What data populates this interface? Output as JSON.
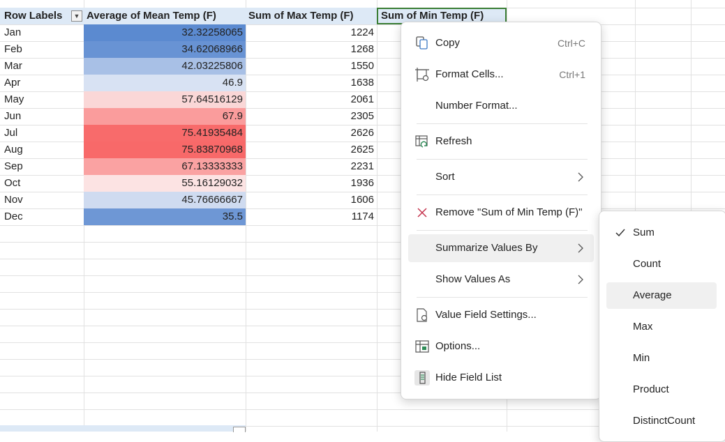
{
  "pivot": {
    "headers": {
      "row_labels": "Row Labels",
      "mean": "Average of Mean Temp (F)",
      "max": "Sum of Max Temp (F)",
      "min": "Sum of Min Temp (F)"
    },
    "rows": [
      {
        "label": "Jan",
        "mean": "32.32258065",
        "max": "1224",
        "color": "#5b8ad0"
      },
      {
        "label": "Feb",
        "mean": "34.62068966",
        "max": "1268",
        "color": "#6893d4"
      },
      {
        "label": "Mar",
        "mean": "42.03225806",
        "max": "1550",
        "color": "#a8c0e6"
      },
      {
        "label": "Apr",
        "mean": "46.9",
        "max": "1638",
        "color": "#d8e2f3"
      },
      {
        "label": "May",
        "mean": "57.64516129",
        "max": "2061",
        "color": "#fad7d7"
      },
      {
        "label": "Jun",
        "mean": "67.9",
        "max": "2305",
        "color": "#fa9c9c"
      },
      {
        "label": "Jul",
        "mean": "75.41935484",
        "max": "2626",
        "color": "#f86b6b"
      },
      {
        "label": "Aug",
        "mean": "75.83870968",
        "max": "2625",
        "color": "#f86969"
      },
      {
        "label": "Sep",
        "mean": "67.13333333",
        "max": "2231",
        "color": "#faa2a2"
      },
      {
        "label": "Oct",
        "mean": "55.16129032",
        "max": "1936",
        "color": "#fce3e3"
      },
      {
        "label": "Nov",
        "mean": "45.76666667",
        "max": "1606",
        "color": "#cfdbf0"
      },
      {
        "label": "Dec",
        "mean": "35.5",
        "max": "1174",
        "color": "#6e97d5"
      }
    ]
  },
  "context_menu": {
    "copy": {
      "label": "Copy",
      "shortcut": "Ctrl+C"
    },
    "format_cells": {
      "label": "Format Cells...",
      "shortcut": "Ctrl+1"
    },
    "number_format": {
      "label": "Number Format..."
    },
    "refresh": {
      "label": "Refresh"
    },
    "sort": {
      "label": "Sort"
    },
    "remove": {
      "label": "Remove \"Sum of Min Temp (F)\""
    },
    "summarize": {
      "label": "Summarize Values By"
    },
    "show_values": {
      "label": "Show Values As"
    },
    "value_field_settings": {
      "label": "Value Field Settings..."
    },
    "options": {
      "label": "Options..."
    },
    "hide_field_list": {
      "label": "Hide Field List"
    }
  },
  "summarize_submenu": {
    "items": [
      "Sum",
      "Count",
      "Average",
      "Max",
      "Min",
      "Product",
      "DistinctCount"
    ],
    "checked": "Sum",
    "hovered": "Average"
  },
  "colors": {
    "header_bg": "#dde9f6",
    "selected_border": "#3a7d34",
    "remove_icon": "#c4314b",
    "refresh_accent": "#2e8b57"
  }
}
